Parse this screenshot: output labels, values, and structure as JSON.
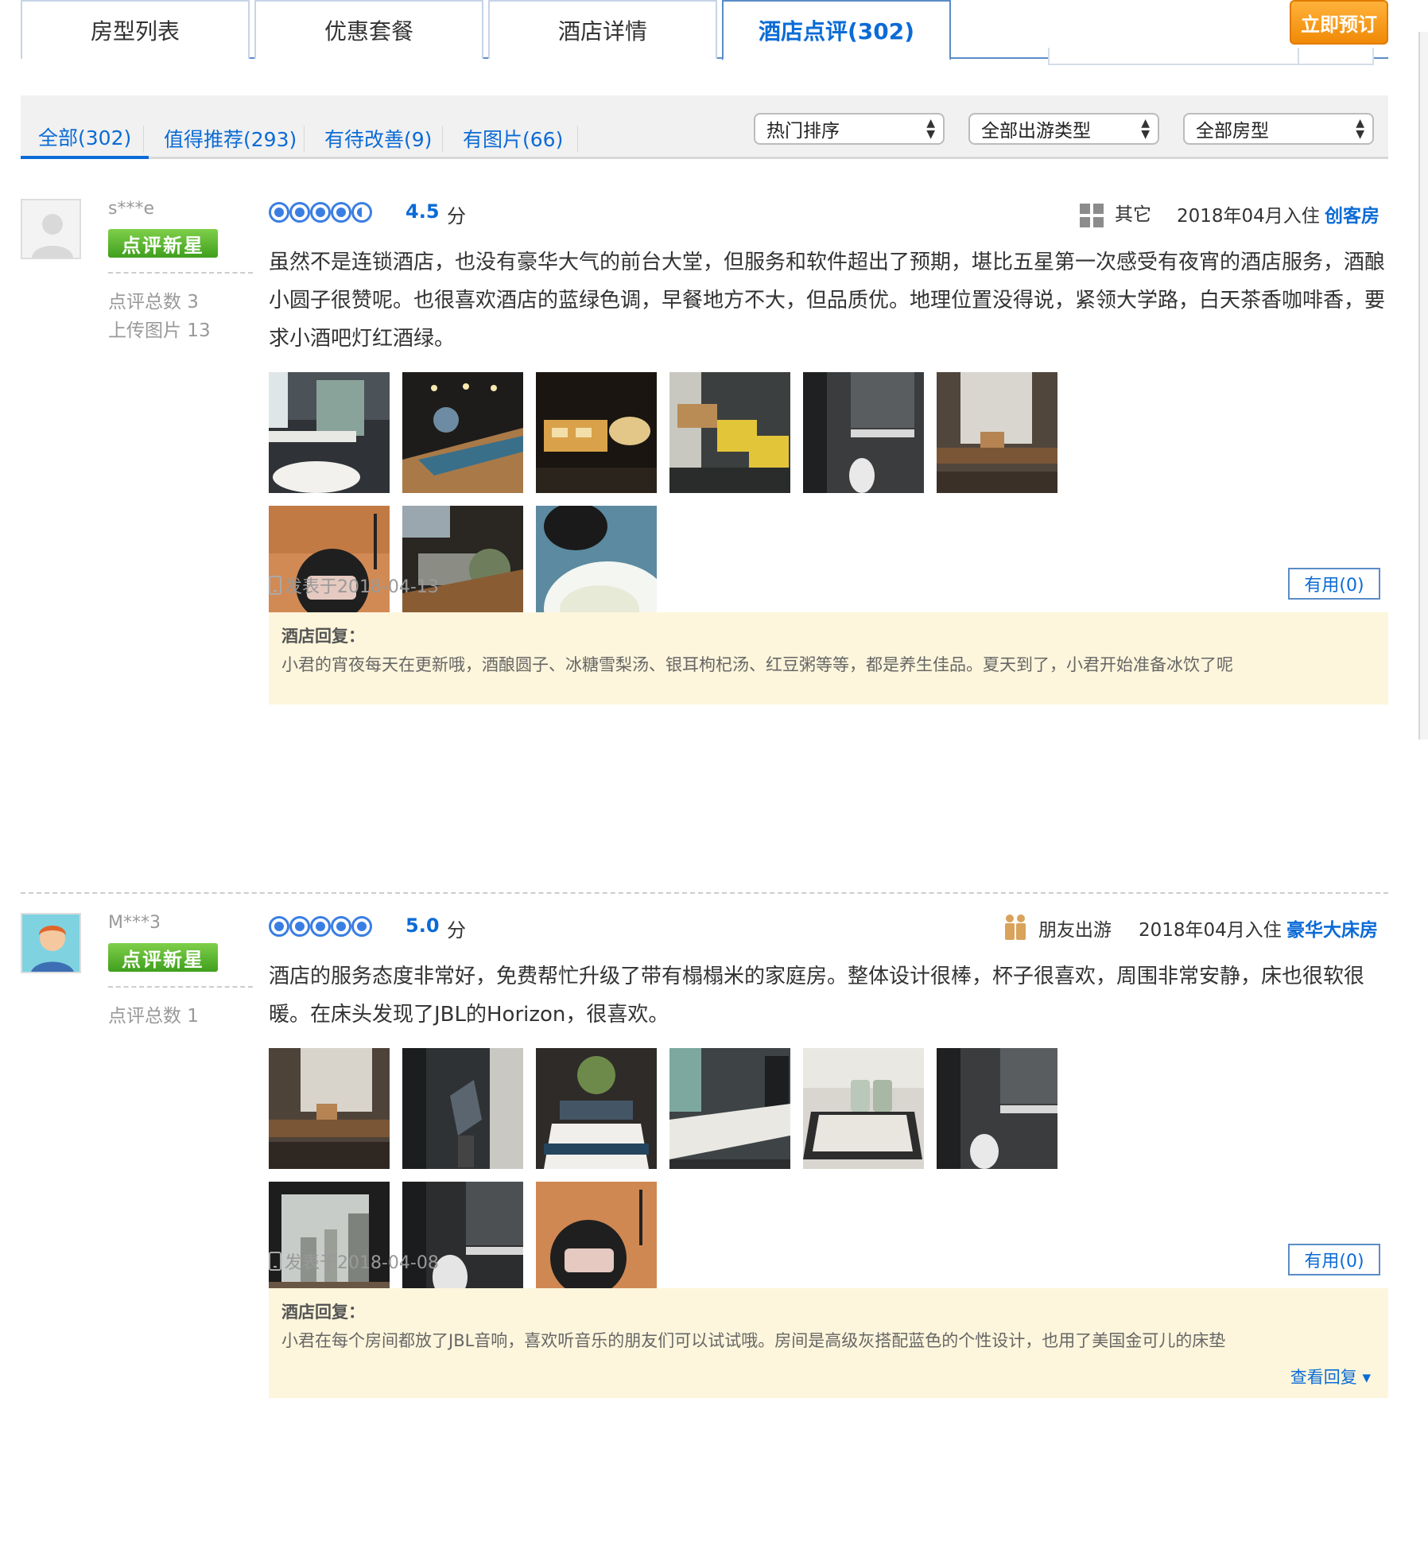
{
  "tabs": [
    {
      "label": "房型列表"
    },
    {
      "label": "优惠套餐"
    },
    {
      "label": "酒店详情"
    },
    {
      "label": "酒店点评(302)"
    }
  ],
  "book_button": "立即预订",
  "filter_tabs": [
    {
      "label": "全部(302)"
    },
    {
      "label": "值得推荐(293)"
    },
    {
      "label": "有待改善(9)"
    },
    {
      "label": "有图片(66)"
    }
  ],
  "selects": [
    {
      "value": "热门排序"
    },
    {
      "value": "全部出游类型"
    },
    {
      "value": "全部房型"
    }
  ],
  "colors": {
    "accent": "#0b6bd6",
    "badge": "#4caf24",
    "book": "#f5960f",
    "reply_bg": "#fdf6dc"
  },
  "reviews": [
    {
      "user": "s***e",
      "badge": "点评新星",
      "stats": [
        "点评总数 3",
        "上传图片 13"
      ],
      "rating": 4.5,
      "score": "4.5",
      "score_unit": "分",
      "trip_type": "其它",
      "trip_icon": "grid-icon",
      "stay": "2018年04月入住",
      "room": "创客房",
      "content": "虽然不是连锁酒店，也没有豪华大气的前台大堂，但服务和软件超出了预期，堪比五星第一次感受有夜宵的酒店服务，酒酿小圆子很赞呢。也很喜欢酒店的蓝绿色调，早餐地方不大，但品质优。地理位置没得说，紧领大学路，白天茶香咖啡香，要求小酒吧灯红酒绿。",
      "posted": "发表于2018-04-13",
      "useful": "有用(0)",
      "reply_title": "酒店回复：",
      "reply_text": "小君的宵夜每天在更新哦，酒酿圆子、冰糖雪梨汤、银耳枸杞汤、红豆粥等等，都是养生佳品。夏天到了，小君开始准备冰饮了呢",
      "photos": [
        "bathroom-bathtub",
        "dining-room",
        "breakfast-pastries",
        "breakfast-buffet",
        "bathroom-toilet",
        "room-tatami",
        "jbl-speaker",
        "buffet-table",
        "dessert-bowl"
      ]
    },
    {
      "user": "M***3",
      "badge": "点评新星",
      "stats": [
        "点评总数 1"
      ],
      "rating": 5,
      "score": "5.0",
      "score_unit": "分",
      "trip_type": "朋友出游",
      "trip_icon": "friends-icon",
      "stay": "2018年04月入住",
      "room": "豪华大床房",
      "content": "酒店的服务态度非常好，免费帮忙升级了带有榻榻米的家庭房。整体设计很棒，杯子很喜欢，周围非常安静，床也很软很暖。在床头发现了JBL的Horizon，很喜欢。",
      "posted": "发表于2018-04-08",
      "useful": "有用(0)",
      "reply_title": "酒店回复：",
      "reply_text": "小君在每个房间都放了JBL音响，喜欢听音乐的朋友们可以试试哦。房间是高级灰搭配蓝色的个性设计，也用了美国金可儿的床垫",
      "view_reply": "查看回复 ▾",
      "photos": [
        "room-tatami",
        "sculpture-corner",
        "bed-headboard",
        "vanity-sink",
        "cups-tray",
        "bathroom-toilet",
        "window-view",
        "bathroom-dark",
        "jbl-speaker"
      ]
    }
  ]
}
